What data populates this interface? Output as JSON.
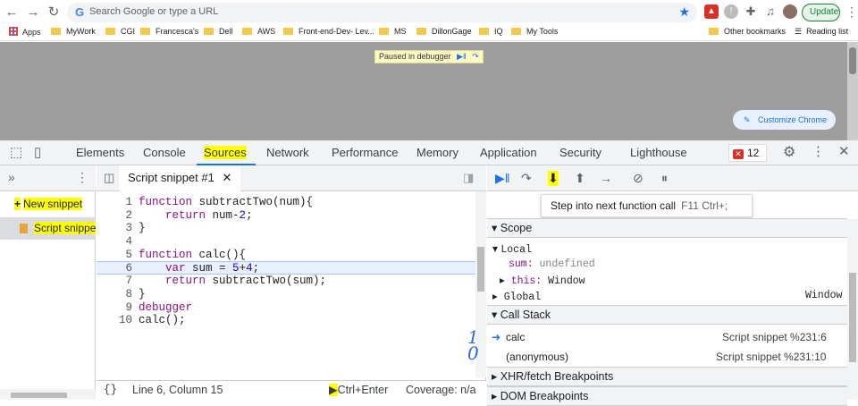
{
  "browser": {
    "omnibox_placeholder": "Search Google or type a URL",
    "update_label": "Update",
    "bookmarks": [
      {
        "label": "Apps",
        "kind": "apps"
      },
      {
        "label": "MyWork",
        "kind": "folder"
      },
      {
        "label": "CGI",
        "kind": "folder"
      },
      {
        "label": "Francesca's",
        "kind": "folder"
      },
      {
        "label": "Dell",
        "kind": "folder"
      },
      {
        "label": "AWS",
        "kind": "folder"
      },
      {
        "label": "Front-end-Dev- Lev...",
        "kind": "folder"
      },
      {
        "label": "MS",
        "kind": "folder"
      },
      {
        "label": "DillonGage",
        "kind": "folder"
      },
      {
        "label": "IQ",
        "kind": "folder"
      },
      {
        "label": "My Tools",
        "kind": "folder"
      }
    ],
    "other_bookmarks": "Other bookmarks",
    "reading_list": "Reading list"
  },
  "viewport": {
    "paused_label": "Paused in debugger",
    "customize_label": "Customize Chrome"
  },
  "devtools": {
    "tabs": [
      "Elements",
      "Console",
      "Sources",
      "Network",
      "Performance",
      "Memory",
      "Application",
      "Security",
      "Lighthouse"
    ],
    "active_tab": "Sources",
    "error_count": "12",
    "navigator": {
      "new_snippet": "New snippet",
      "snippet_item": "Script snippet"
    },
    "editor": {
      "tab_label": "Script snippet #1",
      "line_numbers": [
        "1",
        "2",
        "3",
        "4",
        "5",
        "6",
        "7",
        "8",
        "9",
        "10"
      ],
      "code_lines": [
        "function subtractTwo(num){",
        "    return num-2;",
        "}",
        "",
        "function calc(){",
        "    var sum = 5+4;",
        "    return subtractTwo(sum);",
        "}",
        "debugger",
        "calc();"
      ],
      "status_position": "Line 6, Column 15",
      "run_shortcut": "Ctrl+Enter",
      "coverage": "Coverage: n/a",
      "annotation": "10"
    },
    "debugger": {
      "tooltip": "Step into next function call",
      "tooltip_keys": "F11  Ctrl+;",
      "scope_title": "Scope",
      "local_title": "Local",
      "locals": [
        {
          "name": "sum:",
          "value": "undefined"
        },
        {
          "name": "this:",
          "value": "Window"
        }
      ],
      "global_name": "Global",
      "global_value": "Window",
      "call_stack_title": "Call Stack",
      "frames": [
        {
          "fn": "calc",
          "loc": "Script snippet %231:6"
        },
        {
          "fn": "(anonymous)",
          "loc": "Script snippet %231:10"
        }
      ],
      "xhr_title": "XHR/fetch Breakpoints",
      "dom_title": "DOM Breakpoints"
    }
  }
}
